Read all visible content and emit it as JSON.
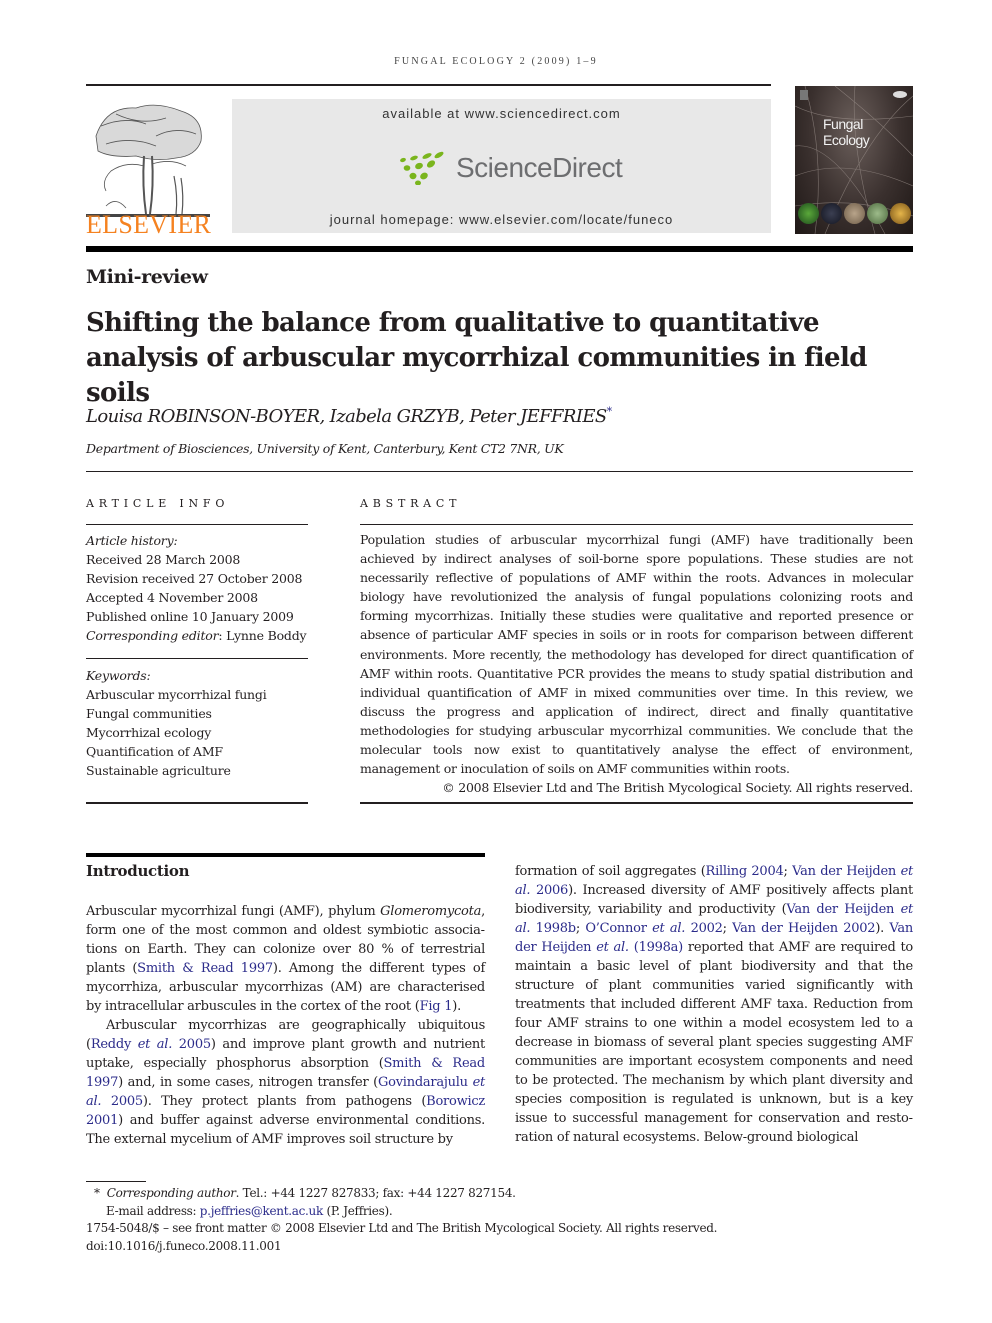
{
  "header": {
    "running_head": "FUNGAL ECOLOGY 2 (2009) 1–9",
    "publisher_wordmark": "ELSEVIER",
    "available_at": "available at www.sciencedirect.com",
    "sciencedirect_logo_text": "ScienceDirect",
    "journal_homepage": "journal homepage: www.elsevier.com/locate/funeco",
    "cover_title_line1": "Fungal",
    "cover_title_line2": "Ecology",
    "colors": {
      "elsevier_orange": "#f58220",
      "sciencedirect_green": "#7ab51d",
      "sciencedirect_gray": "#6d6e70",
      "link_blue": "#2b2b8a",
      "banner_gray": "#e8e8e8"
    }
  },
  "article": {
    "section_type": "Mini-review",
    "title": "Shifting the balance from qualitative to quantitative analysis of arbuscular mycorrhizal communities in field soils",
    "authors": "Louisa ROBINSON-BOYER, Izabela GRZYB, Peter JEFFRIES",
    "author_mark": "*",
    "affiliation": "Department of Biosciences, University of Kent, Canterbury, Kent CT2 7NR, UK"
  },
  "article_info": {
    "heading": "ARTICLE INFO",
    "history_label": "Article history:",
    "history": [
      "Received 28 March 2008",
      "Revision received 27 October 2008",
      "Accepted 4 November 2008",
      "Published online 10 January 2009"
    ],
    "editor_label": "Corresponding editor",
    "editor_name": ": Lynne Boddy",
    "keywords_label": "Keywords:",
    "keywords": [
      "Arbuscular mycorrhizal fungi",
      "Fungal communities",
      "Mycorrhizal ecology",
      "Quantification of AMF",
      "Sustainable agriculture"
    ]
  },
  "abstract": {
    "heading": "ABSTRACT",
    "text": "Population studies of arbuscular mycorrhizal fungi (AMF) have traditionally been achieved by indirect analyses of soil-borne spore populations. These studies are not necessarily reflective of populations of AMF within the roots. Advances in molecular biology have revolutionized the analysis of fungal populations colonizing roots and forming mycor­rhizas. Initially these studies were qualitative and reported presence or absence of particular AMF species in soils or in roots for comparison between different environments. More recently, the methodology has developed for direct quantification of AMF within roots. Quantitative PCR provides the means to study spatial distribution and individual quantification of AMF in mixed communities over time. In this review, we discuss the progress and application of indirect, direct and finally quantitative methodologies for studying arbuscular mycorrhizal communities. We conclude that the molecular tools now exist to quantitatively analyse the effect of environment, management or inoculation of soils on AMF communities within roots.",
    "copyright": "© 2008 Elsevier Ltd and The British Mycological Society. All rights reserved."
  },
  "introduction": {
    "heading": "Introduction",
    "p1": {
      "t1": "Arbuscular mycorrhizal fungi (AMF), phylum ",
      "genus": "Glomeromycota",
      "t2": ", form one of the most common and oldest symbiotic associa­tions on Earth. They can colonize over 80 % of terrestrial plants (",
      "r1": "Smith & Read 1997",
      "t3": "). Among the different types of mycorrhiza, arbuscular mycorrhizas (AM) are characterised by intracellular arbuscules in the cortex of the root (",
      "r2": "Fig 1",
      "t4": ")."
    },
    "p2": {
      "t1": "Arbuscular mycorrhizas are geographically ubiquitous (",
      "r1a": "Reddy ",
      "r1b": "et al.",
      "r1c": " 2005",
      "t2": ") and improve plant growth and nutrient uptake, especially phosphorus absorption (",
      "r2": "Smith & Read 1997",
      "t3": ") and, in some cases, nitrogen transfer (",
      "r3a": "Govindarajulu ",
      "r3b": "et al.",
      "r3c": " 2005",
      "t4": "). They protect plants from pathogens (",
      "r4": "Borowicz 2001",
      "t5": ") and buffer against adverse environmental conditions. The external mycelium of AMF improves soil structure by formation of soil aggregates (",
      "r5": "Rilling 2004",
      "t6": "; ",
      "r6a": "Van der Heijden ",
      "r6b": "et al.",
      "r6c": " 2006",
      "t7": "). Increased diversity of AMF positively affects plant biodiversity, variability and productivity (",
      "r7a": "Van der Heijden ",
      "r7b": "et al.",
      "r7c": " 1998b",
      "t8": "; ",
      "r8a": "O’Connor ",
      "r8b": "et al.",
      "r8c": " 2002",
      "t9": "; ",
      "r9": "Van der Heijden 2002",
      "t10": "). ",
      "r10a": "Van der Heijden ",
      "r10b": "et al.",
      "r10c": " (1998a)",
      "t11": " reported that AMF are required to maintain a basic level of plant biodiversity and that the structure of plant communities varied significantly with treatments that included different AMF taxa. Reduction from four AMF strains to one within a model ecosystem led to a decrease in biomass of several plant species suggesting AMF communities are important ecosystem components and need to be protected. The mechanism by which plant diversity and species composition is regulated is unknown, but is a key issue to successful management for conservation and resto­ration of natural ecosystems. Below-ground biological"
    }
  },
  "footnote": {
    "mark": "*",
    "corr_label": "Corresponding author",
    "corr_text": ". Tel.: +44 1227 827833; fax: +44 1227 827154.",
    "email_label": "E-mail address: ",
    "email": "p.jeffries@kent.ac.uk",
    "email_suffix": " (P. Jeffries).",
    "issn_line": "1754-5048/$ – see front matter © 2008 Elsevier Ltd and The British Mycological Society. All rights reserved.",
    "doi": "doi:10.1016/j.funeco.2008.11.001"
  }
}
